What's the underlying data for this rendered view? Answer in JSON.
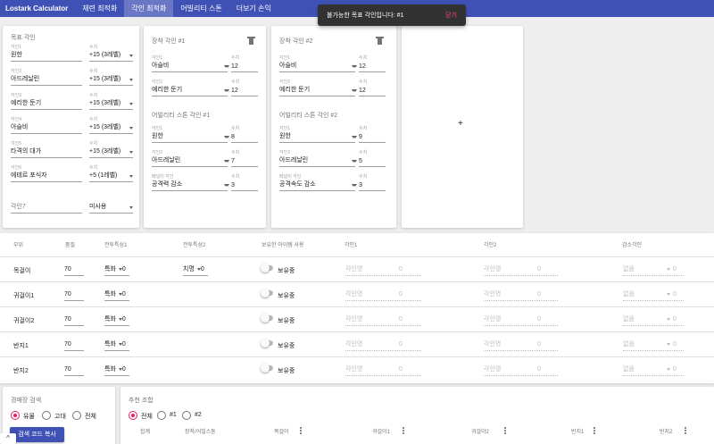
{
  "app": {
    "brand": "Lostark Calculator",
    "nav": [
      {
        "label": "재련 최적화",
        "active": false
      },
      {
        "label": "각인 최적화",
        "active": true
      },
      {
        "label": "어빌리티 스톤",
        "active": false
      },
      {
        "label": "더보기 손익",
        "active": false
      }
    ]
  },
  "snackbar": {
    "message": "불가능한 목표 각인입니다: #1",
    "action": "닫기"
  },
  "target": {
    "title": "목표 각인",
    "rows": [
      {
        "label": "각인1",
        "value": "원한",
        "level_label": "수치",
        "level": "+15 (3레벨)"
      },
      {
        "label": "각인2",
        "value": "아드레날린",
        "level_label": "수치",
        "level": "+15 (3레벨)"
      },
      {
        "label": "각인3",
        "value": "예리한 둔기",
        "level_label": "수치",
        "level": "+15 (3레벨)"
      },
      {
        "label": "각인4",
        "value": "아슬비",
        "level_label": "수치",
        "level": "+15 (3레벨)"
      },
      {
        "label": "각인5",
        "value": "타격의 대가",
        "level_label": "수치",
        "level": "+15 (3레벨)"
      },
      {
        "label": "각인6",
        "value": "에테르 포식자",
        "level_label": "수치",
        "level": "+5 (1레벨)"
      },
      {
        "label": "",
        "value": "각인7",
        "level_label": "",
        "level": "미사용"
      }
    ]
  },
  "equip": [
    {
      "title": "장착 각인 #1",
      "engr": [
        {
          "label": "각인1",
          "value": "아슬비",
          "num_label": "수치",
          "num": "12"
        },
        {
          "label": "각인2",
          "value": "예리한 둔기",
          "num_label": "수치",
          "num": "12"
        }
      ],
      "stone_title": "어빌리티 스톤 각인 #1",
      "stone": [
        {
          "label": "각인1",
          "value": "원한",
          "num_label": "수치",
          "num": "8"
        },
        {
          "label": "각인2",
          "value": "아드레날린",
          "num_label": "수치",
          "num": "7"
        },
        {
          "label": "페널티 각인",
          "value": "공격력 감소",
          "num_label": "수치",
          "num": "3"
        }
      ]
    },
    {
      "title": "장착 각인 #2",
      "engr": [
        {
          "label": "각인1",
          "value": "아슬비",
          "num_label": "수치",
          "num": "12"
        },
        {
          "label": "각인2",
          "value": "예리한 둔기",
          "num_label": "수치",
          "num": "12"
        }
      ],
      "stone_title": "어빌리티 스톤 각인 #2",
      "stone": [
        {
          "label": "각인1",
          "value": "원한",
          "num_label": "수치",
          "num": "9"
        },
        {
          "label": "각인2",
          "value": "아드레날린",
          "num_label": "수치",
          "num": "5"
        },
        {
          "label": "페널티 각인",
          "value": "공격속도 감소",
          "num_label": "수치",
          "num": "3"
        }
      ]
    }
  ],
  "add_icon": "+",
  "acc": {
    "headers": [
      "부위",
      "품질",
      "전투특성1",
      "전투특성2",
      "보유한 아이템 사용",
      "각인1",
      "각인2",
      "감소각인"
    ],
    "rows": [
      {
        "name": "목걸이",
        "quality": "70",
        "stat1": "특화",
        "stat1_val": "0",
        "stat2": "치명",
        "stat2_val": "0",
        "owned": "보유중",
        "e1": "각인명",
        "e1v": "0",
        "e2": "각인명",
        "e2v": "0",
        "neg": "없음",
        "negv": "0"
      },
      {
        "name": "귀걸이1",
        "quality": "70",
        "stat1": "특화",
        "stat1_val": "0",
        "stat2": "",
        "stat2_val": "",
        "owned": "보유중",
        "e1": "각인명",
        "e1v": "0",
        "e2": "각인명",
        "e2v": "0",
        "neg": "없음",
        "negv": "0"
      },
      {
        "name": "귀걸이2",
        "quality": "70",
        "stat1": "특화",
        "stat1_val": "0",
        "stat2": "",
        "stat2_val": "",
        "owned": "보유중",
        "e1": "각인명",
        "e1v": "0",
        "e2": "각인명",
        "e2v": "0",
        "neg": "없음",
        "negv": "0"
      },
      {
        "name": "반지1",
        "quality": "70",
        "stat1": "특화",
        "stat1_val": "0",
        "stat2": "",
        "stat2_val": "",
        "owned": "보유중",
        "e1": "각인명",
        "e1v": "0",
        "e2": "각인명",
        "e2v": "0",
        "neg": "없음",
        "negv": "0"
      },
      {
        "name": "반지2",
        "quality": "70",
        "stat1": "특화",
        "stat1_val": "0",
        "stat2": "",
        "stat2_val": "",
        "owned": "보유중",
        "e1": "각인명",
        "e1v": "0",
        "e2": "각인명",
        "e2v": "0",
        "neg": "없음",
        "negv": "0"
      }
    ]
  },
  "market": {
    "title": "경매장 검색",
    "options": [
      {
        "label": "유물",
        "checked": true
      },
      {
        "label": "고대",
        "checked": false
      },
      {
        "label": "전체",
        "checked": false
      }
    ],
    "copy_button": "검색 코드 복사"
  },
  "reco": {
    "title": "추천 조합",
    "options": [
      {
        "label": "전체",
        "checked": true
      },
      {
        "label": "#1",
        "checked": false
      },
      {
        "label": "#2",
        "checked": false
      }
    ],
    "columns": [
      "합계",
      "장착/어빌스톤",
      "목걸이",
      "귀걸이1",
      "귀걸이2",
      "반지1",
      "반지2"
    ]
  },
  "expand_icon": "^"
}
